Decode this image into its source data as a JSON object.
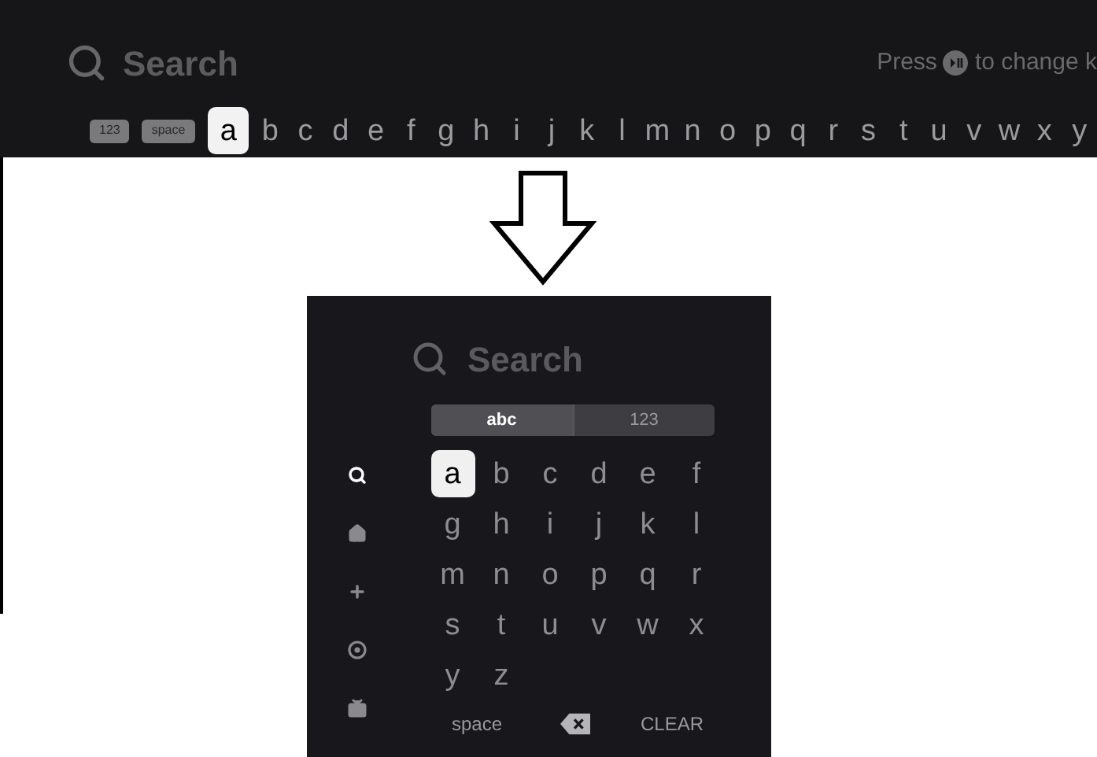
{
  "top_screen": {
    "search": {
      "placeholder": "Search"
    },
    "hint": {
      "before": "Press",
      "after": "to change k"
    },
    "keys": [
      {
        "label": "123",
        "kind": "mode",
        "selected": false
      },
      {
        "label": "space",
        "kind": "mode",
        "selected": false
      },
      {
        "label": "a",
        "kind": "letter",
        "selected": true
      },
      {
        "label": "b",
        "kind": "letter",
        "selected": false
      },
      {
        "label": "c",
        "kind": "letter",
        "selected": false
      },
      {
        "label": "d",
        "kind": "letter",
        "selected": false
      },
      {
        "label": "e",
        "kind": "letter",
        "selected": false
      },
      {
        "label": "f",
        "kind": "letter",
        "selected": false
      },
      {
        "label": "g",
        "kind": "letter",
        "selected": false
      },
      {
        "label": "h",
        "kind": "letter",
        "selected": false
      },
      {
        "label": "i",
        "kind": "letter",
        "selected": false
      },
      {
        "label": "j",
        "kind": "letter",
        "selected": false
      },
      {
        "label": "k",
        "kind": "letter",
        "selected": false
      },
      {
        "label": "l",
        "kind": "letter",
        "selected": false
      },
      {
        "label": "m",
        "kind": "letter",
        "selected": false
      },
      {
        "label": "n",
        "kind": "letter",
        "selected": false
      },
      {
        "label": "o",
        "kind": "letter",
        "selected": false
      },
      {
        "label": "p",
        "kind": "letter",
        "selected": false
      },
      {
        "label": "q",
        "kind": "letter",
        "selected": false
      },
      {
        "label": "r",
        "kind": "letter",
        "selected": false
      },
      {
        "label": "s",
        "kind": "letter",
        "selected": false
      },
      {
        "label": "t",
        "kind": "letter",
        "selected": false
      },
      {
        "label": "u",
        "kind": "letter",
        "selected": false
      },
      {
        "label": "v",
        "kind": "letter",
        "selected": false
      },
      {
        "label": "w",
        "kind": "letter",
        "selected": false
      },
      {
        "label": "x",
        "kind": "letter",
        "selected": false
      },
      {
        "label": "y",
        "kind": "letter",
        "selected": false
      }
    ]
  },
  "bottom_screen": {
    "search": {
      "placeholder": "Search"
    },
    "tabs": [
      {
        "label": "abc",
        "selected": true
      },
      {
        "label": "123",
        "selected": false
      }
    ],
    "sidebar": {
      "items": [
        {
          "kind": "search",
          "selected": true
        },
        {
          "kind": "home",
          "selected": false
        },
        {
          "kind": "add",
          "selected": false
        },
        {
          "kind": "sports",
          "selected": false
        },
        {
          "kind": "tv",
          "selected": false
        }
      ]
    },
    "keys": [
      {
        "label": "a",
        "selected": true
      },
      {
        "label": "b",
        "selected": false
      },
      {
        "label": "c",
        "selected": false
      },
      {
        "label": "d",
        "selected": false
      },
      {
        "label": "e",
        "selected": false
      },
      {
        "label": "f",
        "selected": false
      },
      {
        "label": "g",
        "selected": false
      },
      {
        "label": "h",
        "selected": false
      },
      {
        "label": "i",
        "selected": false
      },
      {
        "label": "j",
        "selected": false
      },
      {
        "label": "k",
        "selected": false
      },
      {
        "label": "l",
        "selected": false
      },
      {
        "label": "m",
        "selected": false
      },
      {
        "label": "n",
        "selected": false
      },
      {
        "label": "o",
        "selected": false
      },
      {
        "label": "p",
        "selected": false
      },
      {
        "label": "q",
        "selected": false
      },
      {
        "label": "r",
        "selected": false
      },
      {
        "label": "s",
        "selected": false
      },
      {
        "label": "t",
        "selected": false
      },
      {
        "label": "u",
        "selected": false
      },
      {
        "label": "v",
        "selected": false
      },
      {
        "label": "w",
        "selected": false
      },
      {
        "label": "x",
        "selected": false
      },
      {
        "label": "y",
        "selected": false
      },
      {
        "label": "z",
        "selected": false
      }
    ],
    "actions": [
      {
        "kind": "text",
        "label": "space"
      },
      {
        "kind": "backspace"
      },
      {
        "kind": "text",
        "label": "CLEAR"
      }
    ]
  }
}
